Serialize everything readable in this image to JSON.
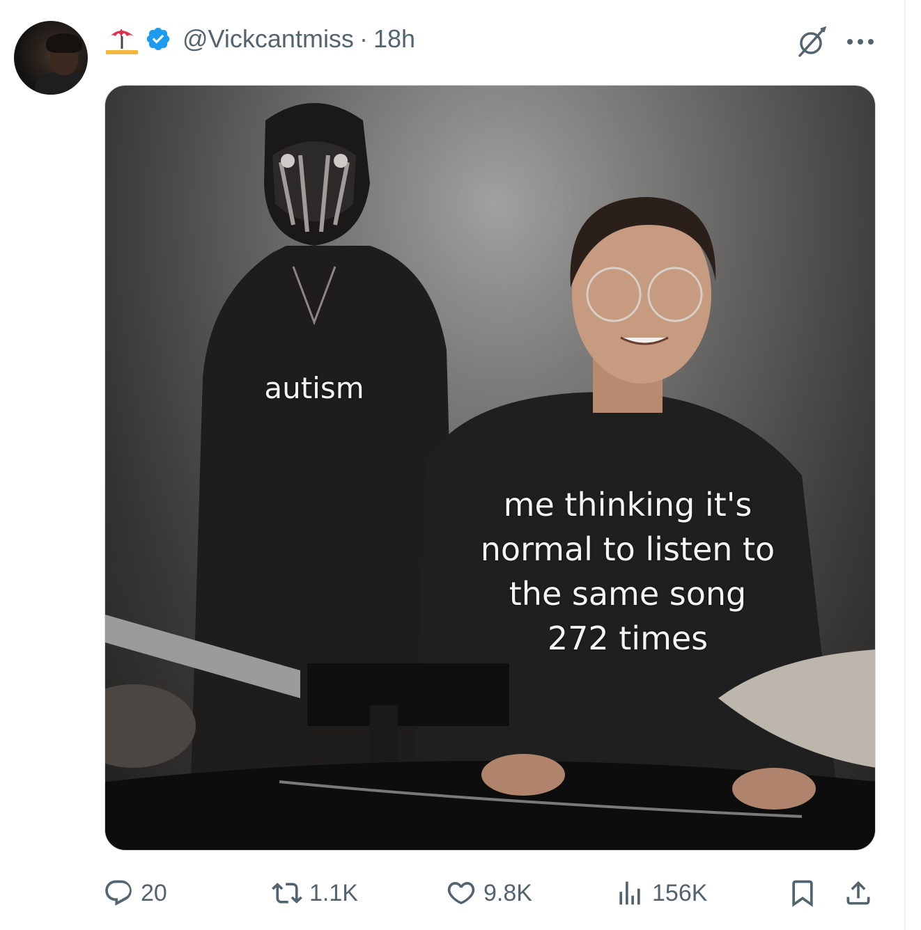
{
  "tweet": {
    "author": {
      "handle": "@Vickcantmiss",
      "emoji_icon": "umbrella-on-ground-icon",
      "verified": true,
      "verified_color": "#1d9bf0"
    },
    "separator": "·",
    "time": "18h",
    "media": {
      "caption_left": "autism",
      "caption_right": "me thinking it's\nnormal to listen to\nthe same song\n272 times"
    },
    "actions": {
      "replies": "20",
      "retweets": "1.1K",
      "likes": "9.8K",
      "views": "156K"
    }
  }
}
